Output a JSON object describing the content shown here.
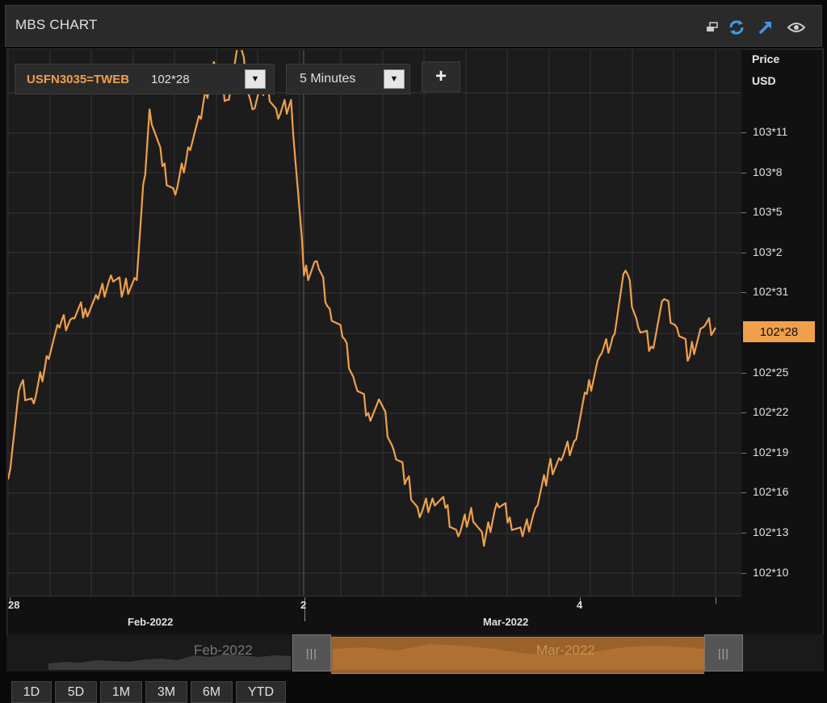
{
  "window": {
    "title": "MBS CHART"
  },
  "toolbar_icons": [
    "popout-icon",
    "refresh-icon",
    "link-arrow-icon",
    "eye-icon"
  ],
  "colors": {
    "accent": "#f0a04b",
    "line": "#f0a04b",
    "background": "#1c1c1c",
    "refresh_icon": "#3aa0e8",
    "link_icon": "#4a90e2"
  },
  "instrument": {
    "ric": "USFN3035=TWEB",
    "last_price": "102*28"
  },
  "interval": {
    "selected": "5 Minutes"
  },
  "add_button": "+",
  "axis": {
    "header_line1": "Price",
    "header_line2": "USD",
    "y_ticks": [
      "103*11",
      "103*8",
      "103*5",
      "103*2",
      "102*31",
      "102*25",
      "102*22",
      "102*19",
      "102*16",
      "102*13",
      "102*10"
    ],
    "current_price": "102*28"
  },
  "x_axis": {
    "labels": [
      {
        "text": "28",
        "sub": "Feb-2022"
      },
      {
        "text": "2",
        "sub": ""
      },
      {
        "text": "4",
        "sub": "Mar-2022"
      }
    ]
  },
  "navigator": {
    "left_label": "Feb-2022",
    "right_label": "Mar-2022",
    "handle_glyph": "|||"
  },
  "ranges": [
    "1D",
    "5D",
    "1M",
    "3M",
    "6M",
    "YTD"
  ],
  "chart_data": {
    "type": "line",
    "series": [
      {
        "values": [
          102.52,
          102.72,
          102.68,
          102.78,
          102.84,
          102.86,
          102.88,
          102.9,
          102.95,
          102.92,
          102.94,
          103.3,
          103.18,
          103.12,
          103.22,
          103.28,
          103.4,
          103.32,
          103.44,
          103.3,
          103.36,
          103.28,
          103.32,
          102.95,
          102.98,
          102.88,
          102.82,
          102.72,
          102.66,
          102.68,
          102.58,
          102.52,
          102.44,
          102.48,
          102.46,
          102.4,
          102.46,
          102.38,
          102.47,
          102.44,
          102.4,
          102.46,
          102.54,
          102.56,
          102.6,
          102.7,
          102.78,
          102.82,
          102.96,
          102.84,
          102.8,
          102.9,
          102.84,
          102.78,
          102.84,
          102.84
        ]
      }
    ],
    "y_ticks": [
      "103*11",
      "103*8",
      "103*5",
      "103*2",
      "102*31",
      "102*25",
      "102*22",
      "102*19",
      "102*16",
      "102*13",
      "102*10"
    ],
    "x_labels": [
      "28",
      "2",
      "4"
    ],
    "x_sublabels": [
      "Feb-2022",
      "Mar-2022"
    ],
    "ylim": [
      102.275,
      103.425
    ],
    "ylabel": "Price USD",
    "grid": true,
    "last_value_label": "102*28"
  }
}
